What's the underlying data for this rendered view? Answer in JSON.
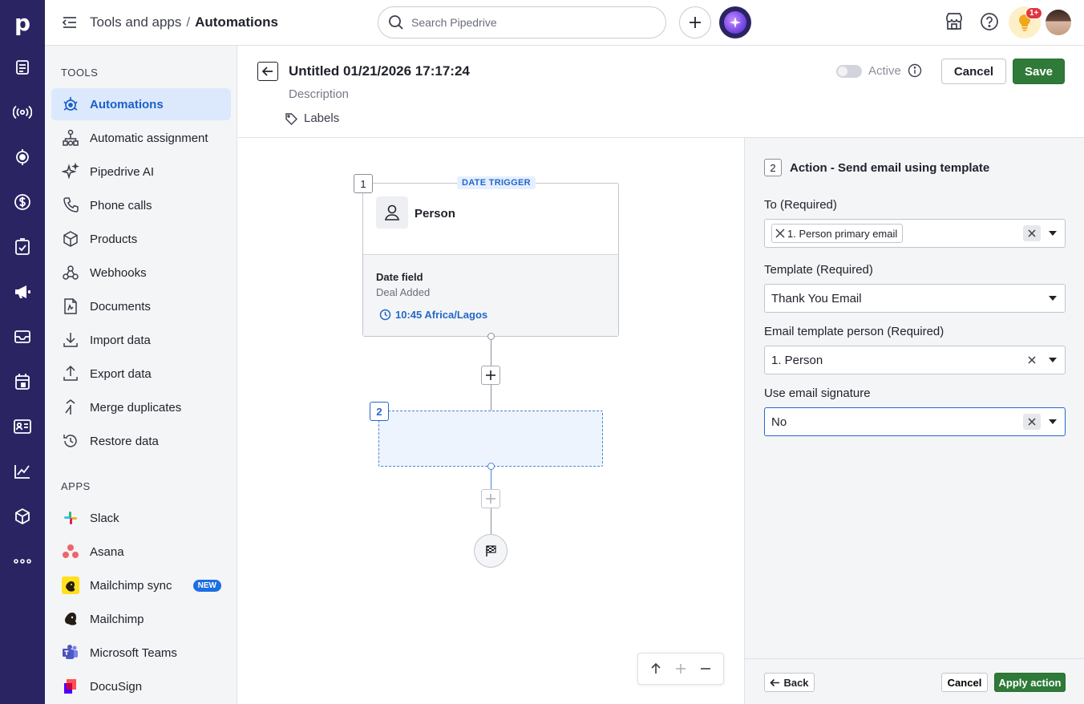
{
  "brand": {
    "logo_letter": "p"
  },
  "topbar": {
    "breadcrumb_parent": "Tools and apps",
    "breadcrumb_separator": "/",
    "breadcrumb_current": "Automations",
    "search_placeholder": "Search Pipedrive",
    "notification_count": "1+"
  },
  "sidebar": {
    "tools_title": "TOOLS",
    "tools": [
      {
        "label": "Automations",
        "icon": "robot-icon",
        "active": true
      },
      {
        "label": "Automatic assignment",
        "icon": "assignment-icon"
      },
      {
        "label": "Pipedrive AI",
        "icon": "sparkle-icon"
      },
      {
        "label": "Phone calls",
        "icon": "phone-icon"
      },
      {
        "label": "Products",
        "icon": "box-icon"
      },
      {
        "label": "Webhooks",
        "icon": "webhook-icon"
      },
      {
        "label": "Documents",
        "icon": "document-icon"
      },
      {
        "label": "Import data",
        "icon": "download-icon"
      },
      {
        "label": "Export data",
        "icon": "upload-icon"
      },
      {
        "label": "Merge duplicates",
        "icon": "merge-icon"
      },
      {
        "label": "Restore data",
        "icon": "restore-icon"
      }
    ],
    "apps_title": "APPS",
    "apps": [
      {
        "label": "Slack",
        "icon": "slack-icon"
      },
      {
        "label": "Asana",
        "icon": "asana-icon"
      },
      {
        "label": "Mailchimp sync",
        "icon": "mailchimp-icon",
        "badge": "NEW"
      },
      {
        "label": "Mailchimp",
        "icon": "mailchimp-icon"
      },
      {
        "label": "Microsoft Teams",
        "icon": "teams-icon"
      },
      {
        "label": "DocuSign",
        "icon": "docusign-icon"
      }
    ]
  },
  "editor": {
    "title": "Untitled 01/21/2026 17:17:24",
    "description_placeholder": "Description",
    "labels_label": "Labels",
    "active_label": "Active",
    "cancel_label": "Cancel",
    "save_label": "Save"
  },
  "canvas": {
    "trigger": {
      "number": "1",
      "type_badge": "DATE TRIGGER",
      "entity": "Person",
      "field_title": "Date field",
      "field_value": "Deal Added",
      "time": "10:45 Africa/Lagos"
    },
    "action": {
      "number": "2"
    }
  },
  "panel": {
    "step_number": "2",
    "title": "Action - Send email using template",
    "to_label": "To (Required)",
    "to_chip": "1. Person primary email",
    "template_label": "Template (Required)",
    "template_value": "Thank You Email",
    "person_label": "Email template person (Required)",
    "person_value": "1. Person",
    "signature_label": "Use email signature",
    "signature_value": "No",
    "back_label": "Back",
    "cancel_label": "Cancel",
    "apply_label": "Apply action"
  },
  "colors": {
    "rail": "#2a2463",
    "accent_blue": "#2468c9",
    "save_green": "#2f7a38",
    "active_item_bg": "#dce9fc"
  }
}
